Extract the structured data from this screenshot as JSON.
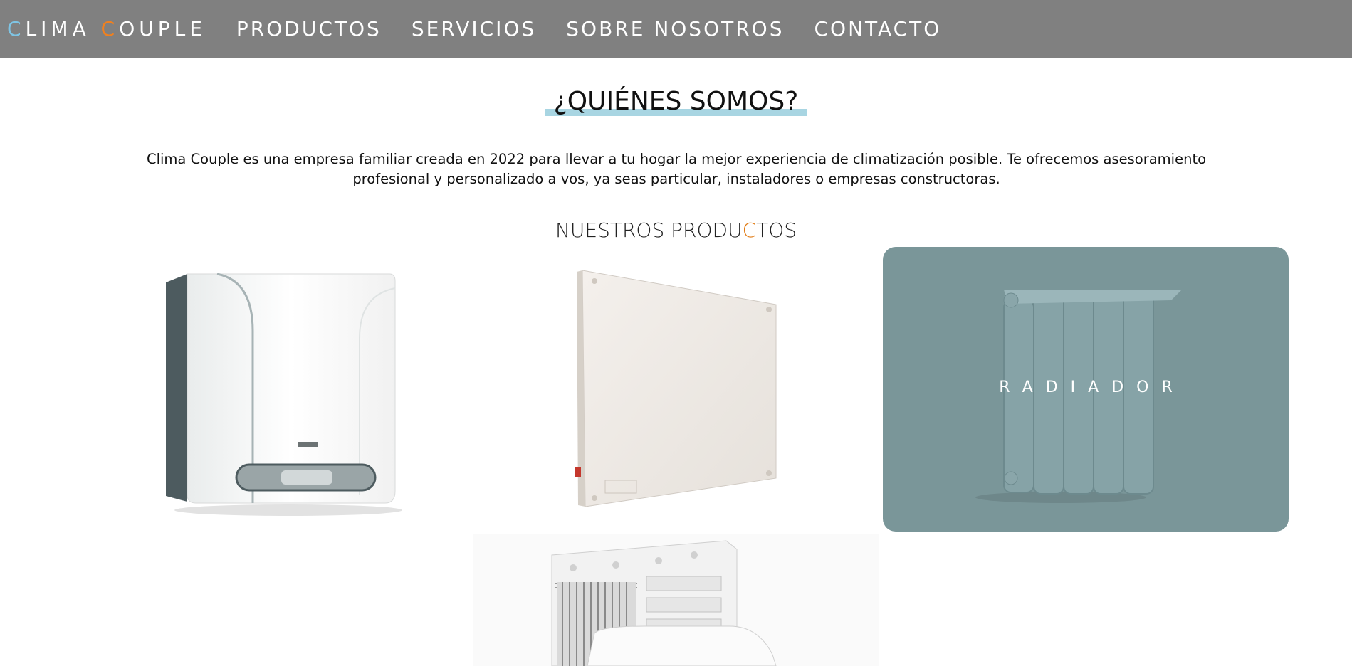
{
  "nav": {
    "brand_c1": "C",
    "brand_rest1": "LIMA",
    "brand_c2": "C",
    "brand_rest2": "OUPLE",
    "links": [
      "PRODUCTOS",
      "SERVICIOS",
      "SOBRE NOSOTROS",
      "CONTACTO"
    ]
  },
  "about": {
    "title": "¿QUIÉNES SOMOS?",
    "text": "Clima Couple es una empresa familiar creada en 2022 para llevar a tu hogar la mejor experiencia de climatización posible. Te ofrecemos asesoramiento profesional y personalizado a vos, ya seas particular, instaladores o empresas constructoras."
  },
  "products": {
    "title_part1": "NUESTROS PRODU",
    "title_highlight": "C",
    "title_part2": "TOS",
    "cards": [
      {
        "icon": "boiler-image",
        "label": ""
      },
      {
        "icon": "panel-heater-image",
        "label": ""
      },
      {
        "icon": "radiator-image",
        "label": "RADIADOR"
      },
      {
        "icon": "air-conditioner-image",
        "label": ""
      }
    ]
  },
  "colors": {
    "navbar": "#808080",
    "brand_c1": "#7ec4e4",
    "brand_c2": "#f0801e",
    "title_underline": "#a8d5e2",
    "radiator_overlay": "#7a9699"
  }
}
